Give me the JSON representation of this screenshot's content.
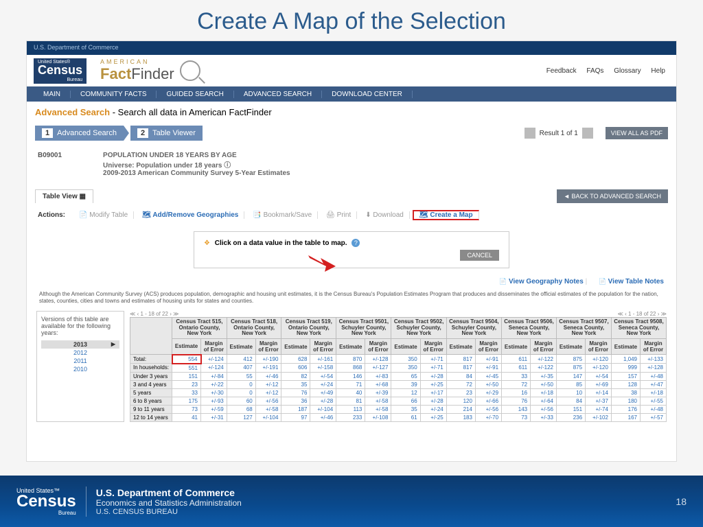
{
  "slide": {
    "title": "Create A Map of the Selection",
    "number": "18"
  },
  "topbar": {
    "dept": "U.S. Department of Commerce"
  },
  "logo": {
    "us": "United States®",
    "census": "Census",
    "bureau": "Bureau"
  },
  "fflogo": {
    "american": "AMERICAN",
    "fact": "Fact",
    "finder": "Finder"
  },
  "headerlinks": {
    "feedback": "Feedback",
    "faqs": "FAQs",
    "glossary": "Glossary",
    "help": "Help"
  },
  "nav": {
    "main": "MAIN",
    "community": "COMMUNITY FACTS",
    "guided": "GUIDED SEARCH",
    "advanced": "ADVANCED SEARCH",
    "download": "DOWNLOAD CENTER"
  },
  "search": {
    "adv": "Advanced Search",
    "rest": " - Search all data in American FactFinder"
  },
  "crumbs": {
    "c1": "Advanced Search",
    "c2": "Table Viewer"
  },
  "results": {
    "text": "Result 1 of 1",
    "viewpdf": "VIEW ALL AS PDF"
  },
  "meta": {
    "code": "B09001",
    "t1": "POPULATION UNDER 18 YEARS BY AGE",
    "t2": "Universe: Population under 18 years",
    "t3": "2009-2013 American Community Survey 5-Year Estimates"
  },
  "tab": {
    "view": "Table View"
  },
  "back": "BACK TO ADVANCED SEARCH",
  "actions": {
    "label": "Actions:",
    "modify": "Modify Table",
    "addgeo": "Add/Remove Geographies",
    "bookmark": "Bookmark/Save",
    "print": "Print",
    "download": "Download",
    "createmap": "Create a Map"
  },
  "hint": {
    "text": "Click on a data value in the table to map.",
    "cancel": "CANCEL"
  },
  "notes": {
    "geo": "View Geography Notes",
    "table": "View Table Notes"
  },
  "disclaimer": "Although the American Community Survey (ACS) produces population, demographic and housing unit estimates, it is the Census Bureau's Population Estimates Program that produces and disseminates the official estimates of the population for the nation, states, counties, cities and towns and estimates of housing units for states and counties.",
  "years": {
    "intro": "Versions of this table are available for the following years:",
    "y13": "2013",
    "y12": "2012",
    "y11": "2011",
    "y10": "2010"
  },
  "pager": {
    "text": "1 - 18 of 22"
  },
  "cols": {
    "c1": "Census Tract 515, Ontario County, New York",
    "c2": "Census Tract 518, Ontario County, New York",
    "c3": "Census Tract 519, Ontario County, New York",
    "c4": "Census Tract 9501, Schuyler County, New York",
    "c5": "Census Tract 9502, Schuyler County, New York",
    "c6": "Census Tract 9504, Schuyler County, New York",
    "c7": "Census Tract 9506, Seneca County, New York",
    "c8": "Census Tract 9507, Seneca County, New York",
    "c9": "Census Tract 9508, Seneca County, New York"
  },
  "subcols": {
    "est": "Estimate",
    "moe": "Margin of Error"
  },
  "rows": {
    "total": "Total:",
    "inhh": "In households:",
    "u3": "Under 3 years",
    "y34": "3 and 4 years",
    "y5": "5 years",
    "y68": "6 to 8 years",
    "y911": "9 to 11 years",
    "y1214": "12 to 14 years"
  },
  "data": {
    "total": [
      "554",
      "+/-124",
      "412",
      "+/-190",
      "628",
      "+/-161",
      "870",
      "+/-128",
      "350",
      "+/-71",
      "817",
      "+/-91",
      "611",
      "+/-122",
      "875",
      "+/-120",
      "1,049",
      "+/-133"
    ],
    "inhh": [
      "551",
      "+/-124",
      "407",
      "+/-191",
      "606",
      "+/-158",
      "868",
      "+/-127",
      "350",
      "+/-71",
      "817",
      "+/-91",
      "611",
      "+/-122",
      "875",
      "+/-120",
      "999",
      "+/-128"
    ],
    "u3": [
      "151",
      "+/-84",
      "55",
      "+/-46",
      "82",
      "+/-54",
      "146",
      "+/-83",
      "65",
      "+/-28",
      "84",
      "+/-45",
      "33",
      "+/-35",
      "147",
      "+/-54",
      "157",
      "+/-48"
    ],
    "y34": [
      "23",
      "+/-22",
      "0",
      "+/-12",
      "35",
      "+/-24",
      "71",
      "+/-68",
      "39",
      "+/-25",
      "72",
      "+/-50",
      "72",
      "+/-50",
      "85",
      "+/-69",
      "128",
      "+/-47"
    ],
    "y5": [
      "33",
      "+/-30",
      "0",
      "+/-12",
      "76",
      "+/-49",
      "40",
      "+/-39",
      "12",
      "+/-17",
      "23",
      "+/-29",
      "16",
      "+/-18",
      "10",
      "+/-14",
      "38",
      "+/-18"
    ],
    "y68": [
      "175",
      "+/-93",
      "60",
      "+/-56",
      "36",
      "+/-28",
      "81",
      "+/-58",
      "66",
      "+/-28",
      "120",
      "+/-66",
      "76",
      "+/-64",
      "84",
      "+/-37",
      "180",
      "+/-55"
    ],
    "y911": [
      "73",
      "+/-59",
      "68",
      "+/-58",
      "187",
      "+/-104",
      "113",
      "+/-58",
      "35",
      "+/-24",
      "214",
      "+/-56",
      "143",
      "+/-56",
      "151",
      "+/-74",
      "176",
      "+/-48"
    ],
    "y1214": [
      "41",
      "+/-31",
      "127",
      "+/-104",
      "97",
      "+/-46",
      "233",
      "+/-108",
      "61",
      "+/-25",
      "183",
      "+/-70",
      "73",
      "+/-33",
      "236",
      "+/-102",
      "167",
      "+/-57"
    ]
  },
  "footer": {
    "us": "United States™",
    "census": "Census",
    "bureau": "Bureau",
    "l1": "U.S. Department of Commerce",
    "l2": "Economics and Statistics Administration",
    "l3": "U.S. CENSUS BUREAU"
  }
}
